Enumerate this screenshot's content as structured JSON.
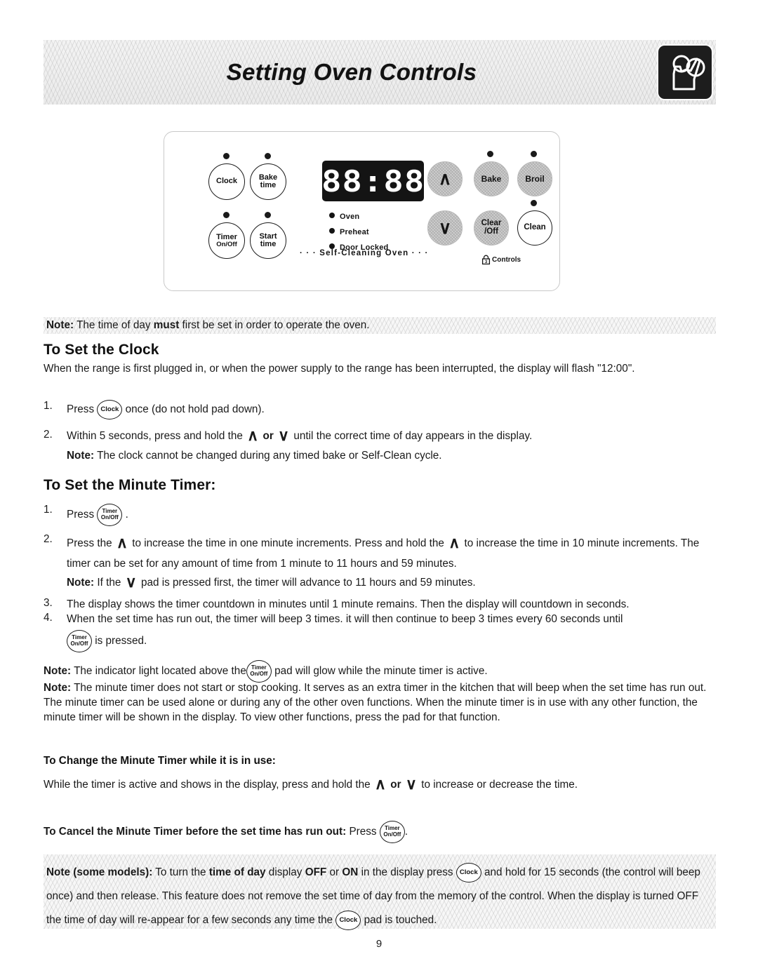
{
  "header": {
    "title": "Setting Oven Controls",
    "icon": "hand-pressing-controls-icon"
  },
  "control_panel": {
    "display_value": "88:88",
    "pads": [
      {
        "id": "clock",
        "label_lines": [
          "Clock"
        ],
        "style": "outline",
        "led": true
      },
      {
        "id": "bake-time",
        "label_lines": [
          "Bake",
          "time"
        ],
        "style": "outline",
        "led": true
      },
      {
        "id": "timer-onoff",
        "label_lines": [
          "Timer",
          "On/Off"
        ],
        "style": "outline",
        "led": true
      },
      {
        "id": "start-time",
        "label_lines": [
          "Start",
          "time"
        ],
        "style": "outline",
        "led": true
      },
      {
        "id": "up-arrow",
        "label_lines": [
          "∧"
        ],
        "style": "grey",
        "led": false
      },
      {
        "id": "down-arrow",
        "label_lines": [
          "∨"
        ],
        "style": "grey",
        "led": false
      },
      {
        "id": "bake",
        "label_lines": [
          "Bake"
        ],
        "style": "grey",
        "led": true
      },
      {
        "id": "broil",
        "label_lines": [
          "Broil"
        ],
        "style": "grey",
        "led": true
      },
      {
        "id": "clear-off",
        "label_lines": [
          "Clear",
          "/Off"
        ],
        "style": "grey",
        "led": false
      },
      {
        "id": "clean",
        "label_lines": [
          "Clean"
        ],
        "style": "outline",
        "led": true
      }
    ],
    "indicators": [
      "Oven",
      "Preheat",
      "Door Locked"
    ],
    "self_cleaning_label": "· · ·  Self-Cleaning Oven  · · ·",
    "controls_lock_label": "Controls",
    "controls_lock_digit": "3"
  },
  "intro_note": {
    "label": "Note:",
    "text_before": " The time of day ",
    "emphasis": "must",
    "text_after": " first be set in order to operate the oven."
  },
  "clock_section": {
    "heading": "To Set the Clock",
    "intro": "When the range is first plugged in, or when the power supply to the range has been interrupted, the display will flash \"12:00\".",
    "step1_num": "1.",
    "step1_a": "Press",
    "step1_pad": "Clock",
    "step1_b": "once (do not hold pad down).",
    "step2_num": "2.",
    "step2_a": "Within 5 seconds, press and hold the",
    "step2_or": "or",
    "step2_b": "until the correct time of day appears in the display.",
    "step2_note_label": "Note:",
    "step2_note": " The clock cannot be changed during any timed bake or Self-Clean cycle."
  },
  "timer_section": {
    "heading": "To Set the Minute Timer:",
    "step1_num": "1.",
    "step1_a": "Press",
    "step1_pad_line1": "Timer",
    "step1_pad_line2": "On/Off",
    "step1_b": ".",
    "step2_num": "2.",
    "step2_a": "Press the",
    "step2_b": "to increase the time in one minute increments. Press and hold the",
    "step2_c": "to increase the time in 10 minute increments. The timer can be set for any amount of time from 1 minute to 11 hours and 59 minutes.",
    "step2_note_label": "Note:",
    "step2_note_a": " If the",
    "step2_note_b": "pad is pressed first, the timer will advance to 11 hours and 59 minutes.",
    "step3_num": "3.",
    "step3": "The display shows the timer countdown in minutes until 1 minute remains. Then the display will countdown in seconds.",
    "step4_num": "4.",
    "step4_a": "When the set time has run out, the timer will beep 3 times. it will then continue to beep 3 times every 60 seconds until",
    "step4_b": "is pressed.",
    "note1_label": "Note:",
    "note1_a": " The indicator light located above the",
    "note1_b": "pad will glow while the minute timer is active.",
    "note2_label": "Note:",
    "note2": " The minute timer does not start or stop cooking. It serves as an extra timer in the kitchen that will beep when the set time has run out. The minute timer can be used alone or during any of the other oven functions. When the minute timer is in use with any other function, the minute timer will be shown in the display. To view other functions, press the pad for that function."
  },
  "change_timer_section": {
    "heading": "To Change the Minute Timer while it is in use:",
    "text_a": "While the timer is active and shows in the display, press and hold the",
    "text_or": "or",
    "text_b": "to increase or decrease the time."
  },
  "cancel_timer_section": {
    "heading": "To Cancel the Minute Timer before the set time has run out:",
    "press_word": " Press",
    "pad_line1": "Timer",
    "pad_line2": "On/Off",
    "period": "."
  },
  "bottom_note": {
    "label": "Note (some models):",
    "a": " To turn the ",
    "b_bold": "time of day",
    "c": " display ",
    "d_bold": "OFF",
    "e": " or ",
    "f_bold": "ON",
    "g": " in the display press",
    "pad": "Clock",
    "h": "and hold for 15 seconds (the control will beep once) and then release. This feature does not remove the set time of day from the memory of the control. When the display is turned OFF the time of day will re-appear for a few seconds any time the",
    "i": "pad is touched."
  },
  "page_number": "9"
}
